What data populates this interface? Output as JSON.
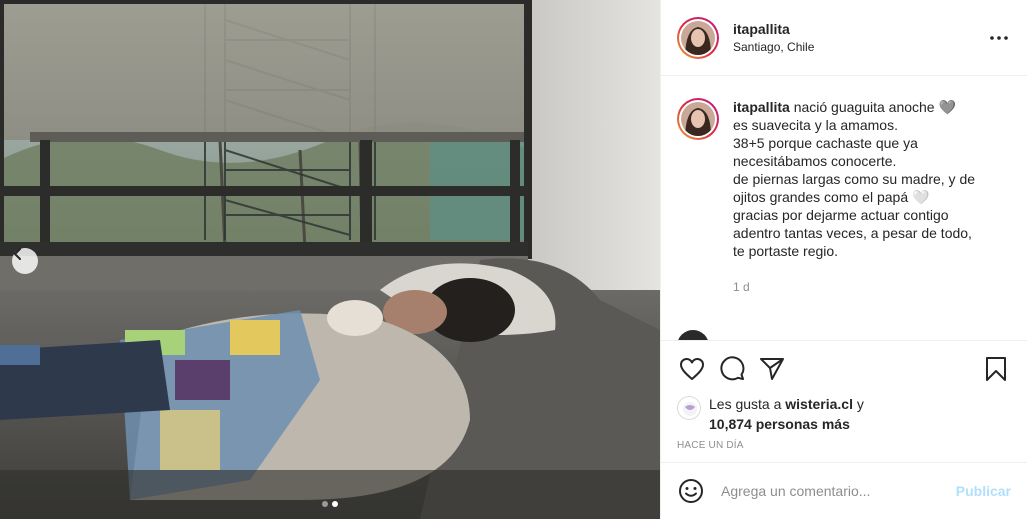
{
  "post": {
    "username": "itapallita",
    "location": "Santiago, Chile",
    "caption": {
      "username": "itapallita",
      "lines": [
        "nació guaguita anoche 🩶",
        "es suavecita y la amamos.",
        "38+5 porque cachaste que ya",
        "necesitábamos conocerte.",
        "de piernas largas como su madre, y de",
        "ojitos grandes como el papá 🤍",
        "gracias por dejarme actuar contigo",
        "adentro tantas veces, a pesar de todo,",
        "te portaste regio."
      ],
      "time": "1 d"
    },
    "likes": {
      "prefix": "Les gusta a ",
      "user": "wisteria.cl",
      "conjunction": " y",
      "count": "10,874 personas más"
    },
    "timeago": "HACE UN DÍA",
    "comment_input": {
      "placeholder": "Agrega un comentario...",
      "publish_label": "Publicar"
    },
    "carousel": {
      "count": 2,
      "active_index": 1
    },
    "icons": {
      "more": "more-options-icon",
      "like": "heart-icon",
      "comment": "comment-icon",
      "share": "paper-plane-icon",
      "save": "bookmark-icon",
      "emoji": "emoji-icon",
      "prev": "chevron-left-icon"
    },
    "colors": {
      "text": "#262626",
      "muted": "#8e8e8e",
      "publish": "#b2dffc",
      "story_ring": [
        "#f09433",
        "#dc2743",
        "#bc1888"
      ]
    }
  }
}
